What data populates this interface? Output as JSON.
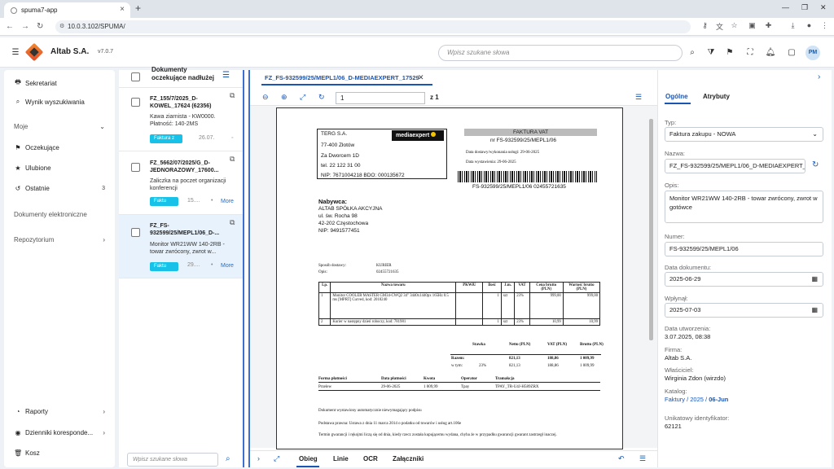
{
  "browser": {
    "tab_title": "spuma7-app",
    "url": "10.0.3.102/SPUMA/"
  },
  "appbar": {
    "company": "Altab S.A.",
    "version": "v7.0.7",
    "search_placeholder": "Wpisz szukane słowa",
    "avatar_initials": "PM"
  },
  "sidebar": {
    "items_top": [
      {
        "label": "Sekretariat",
        "icon": "printer-icon"
      },
      {
        "label": "Wynik wyszukiwania",
        "icon": "search-icon"
      }
    ],
    "moje_header": "Moje",
    "moje_items": [
      {
        "label": "Oczekujące",
        "icon": "flag-icon"
      },
      {
        "label": "Ulubione",
        "icon": "star-icon"
      },
      {
        "label": "Ostatnie",
        "icon": "history-icon",
        "count": "3"
      }
    ],
    "electronic_docs": "Dokumenty elektroniczne",
    "repo": "Repozytorium",
    "items_bottom": [
      {
        "label": "Raporty",
        "icon": "chart-icon"
      },
      {
        "label": "Dzienniki koresponde...",
        "icon": "journal-icon"
      },
      {
        "label": "Kosz",
        "icon": "trash-icon"
      }
    ]
  },
  "list": {
    "title": "Dokumenty oczekujące nadłużej",
    "search_placeholder": "Wpisz szukane słowa",
    "cards": [
      {
        "title": "FZ_155/7/2025_D-KOWEL_17624 (62356)",
        "desc": "Kawa ziarnista - KW0000. Płatność: 140-2MS",
        "pill": "Faktura z",
        "date": "26.07.",
        "more": ""
      },
      {
        "title": "FZ_5662/07/2025/G_D-JEDNORAZOWY_17600...",
        "desc": "Zaliczka na poczet organizacji konferencji",
        "pill": "Faktu",
        "date": "15....",
        "more": "More"
      },
      {
        "title": "FZ_FS-932599/25/MEPL1/06_D-...",
        "desc": "Monitor WR21WW 140-2RB - towar zwrócony, zwrot w...",
        "pill": "Faktu",
        "date": "29....",
        "more": "More"
      }
    ]
  },
  "viewer": {
    "doc_tab": "FZ_FS-932599/25/MEPL1/06_D-MEDIAEXPERT_17529",
    "page_value": "1",
    "page_of": "z 1",
    "bottom_tabs": [
      "Obieg",
      "Linie",
      "OCR",
      "Załączniki"
    ]
  },
  "invoice": {
    "seller": [
      "TERG S.A.",
      "77-400 Złotów",
      "Za Dworcem 1D",
      "tel. 22 122 31 00",
      "NIP: 7671004218 BDO: 000135672"
    ],
    "logo_text": "mediaexpert",
    "heading": "FAKTURA VAT",
    "number": "nr FS-932599/25/MEPL1/06",
    "delivery_date": "Data dostawy/wykonania usługi: 29-06-2025",
    "issue_date": "Data wystawienia: 29-06-2025",
    "barcode_text": "FS-932599/25/MEPL1/06 02455721635",
    "buyer_label": "Nabywca:",
    "buyer": [
      "ALTAB SPÓŁKA AKCYJNA",
      "ul. św. Rocha 98",
      "42-202 Częstochowa",
      "NIP: 9491577451"
    ],
    "shipping_label": "Sposób dostawy:",
    "shipping_value": "KURIER",
    "desc_label": "Opis:",
    "desc_value": "02455721635",
    "table_headers": [
      "Lp.",
      "Nazwa towaru",
      "PKWiU",
      "Ilość",
      "J.m.",
      "VAT",
      "Cena brutto (PLN)",
      "Wartość brutto (PLN)"
    ],
    "rows": [
      [
        "1",
        "Monitor COOLER MASTER GM34-CWQ2 34\" 3440x1440px 165Hz 0.5 ms [MPRT] Curved, kod: 2018240",
        "",
        "1",
        "szt",
        "23%",
        "999,00",
        "999,00"
      ],
      [
        "2",
        "Kurier w następny dzień roboczy, kod: 781981",
        "",
        "1",
        "szt",
        "23%",
        "10,99",
        "10,99"
      ]
    ],
    "sum_headers": [
      "Stawka",
      "Netto (PLN)",
      "VAT (PLN)",
      "Brutto (PLN)"
    ],
    "sum_total_label": "Razem:",
    "sum_total": [
      "821,13",
      "188,86",
      "1 009,99"
    ],
    "sum_rate_label": "w tym:",
    "sum_rate": [
      "23%",
      "821,13",
      "188,86",
      "1 009,99"
    ],
    "pay_headers": [
      "Forma płatności",
      "Data płatności",
      "Kwota",
      "Operator",
      "Tramakcja"
    ],
    "pay_row": [
      "Przelew",
      "29-06-2025",
      "1 009,99",
      "Tpay",
      "TPAY_TR-U4J-H589ZRX"
    ],
    "footer1": "Dokument wystawiony automatycznie niewymagający podpisu",
    "footer2": "Podstawa prawna: Ustawa z dnia 11 marca 2014 o podatku od towarów i usług art.106e",
    "footer3": "Termin gwarancji i rękojmi liczą się od dnia, kiedy rzecz została kupującemu wydana, chyba że w przypadku gwarancji gwarant zastrzegł inaczej."
  },
  "props": {
    "tabs": [
      "Ogólne",
      "Atrybuty"
    ],
    "typ_label": "Typ:",
    "typ_value": "Faktura zakupu - NOWA",
    "nazwa_label": "Nazwa:",
    "nazwa_value": "FZ_FS-932599/25/MEPL1/06_D-MEDIAEXPERT_...",
    "opis_label": "Opis:",
    "opis_value": "Monitor WR21WW 140-2RB - towar zwrócony, zwrot w gotówce",
    "numer_label": "Numer:",
    "numer_value": "FS-932599/25/MEPL1/06",
    "data_dok_label": "Data dokumentu:",
    "data_dok_value": "2025-06-29",
    "wplynal_label": "Wpłynął:",
    "wplynal_value": "2025-07-03",
    "data_utw_label": "Data utworzenia:",
    "data_utw_value": "3.07.2025, 08:38",
    "firma_label": "Firma:",
    "firma_value": "Altab S.A.",
    "wlasciciel_label": "Właściciel:",
    "wlasciciel_value": "Wirginia Zdon (wirzdo)",
    "katalog_label": "Katalog:",
    "katalog_path": "Faktury / 2025 /",
    "katalog_last": "06-Jun",
    "uid_label": "Unikatowy identyfikator:",
    "uid_value": "62121"
  }
}
